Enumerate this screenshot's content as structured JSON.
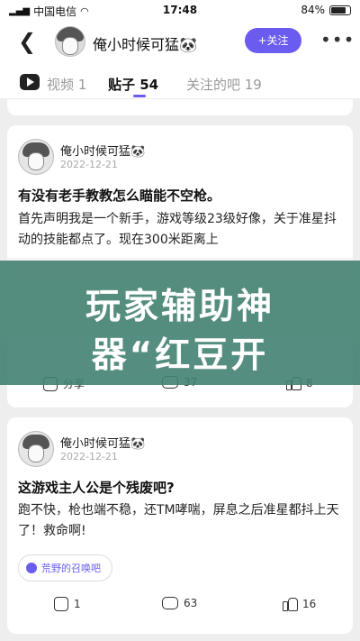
{
  "status_bar": {
    "carrier": "中国电信",
    "time": "17:48",
    "battery": "84%",
    "battery_level": 0.84
  },
  "header": {
    "back_icon": "back-chevron-icon",
    "username": "俺小时候可猛🐼",
    "follow_label": "+关注",
    "more_icon": "more-dots-icon"
  },
  "tabs": [
    {
      "label": "视频 1"
    },
    {
      "label": "贴子 54"
    },
    {
      "label": "关注的吧 19"
    }
  ],
  "overlay": {
    "line1": "玩家辅助神",
    "line2": "器“红豆开"
  },
  "posts": [
    {
      "author": "俺小时候可猛🐼",
      "date": "2022-12-21",
      "title": "有没有老手教教怎么瞄能不空枪。",
      "body": "首先声明我是一个新手，游戏等级23级好像，关于准星抖动的技能都点了。现在300米距离上",
      "actions": {
        "share": "分享",
        "comments": "37",
        "likes": "8"
      }
    },
    {
      "author": "俺小时候可猛🐼",
      "date": "2022-12-21",
      "title": "这游戏主人公是个残废吧?",
      "body": "跑不快，枪也端不稳，还TM哮喘，屏息之后准星都抖上天了！救命啊!",
      "tag": "荒野的召唤吧",
      "actions": {
        "share": "1",
        "comments": "63",
        "likes": "16"
      }
    }
  ],
  "colors": {
    "accent": "#6b5cf0",
    "overlay": "#417f6f",
    "background": "#eeeeee"
  }
}
